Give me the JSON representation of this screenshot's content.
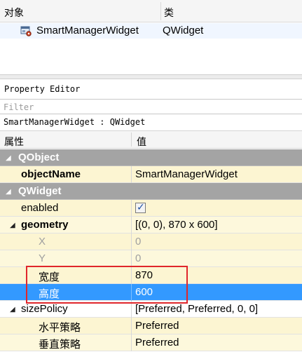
{
  "object_inspector": {
    "col_object": "对象",
    "col_class": "类",
    "row": {
      "name": "SmartManagerWidget",
      "class": "QWidget",
      "icon": "widget-icon"
    }
  },
  "property_editor": {
    "title": "Property Editor",
    "filter_placeholder": "Filter",
    "context": "SmartManagerWidget : QWidget",
    "col_property": "属性",
    "col_value": "值",
    "groups": {
      "qobject": "QObject",
      "qwidget": "QWidget"
    },
    "rows": {
      "objectName": {
        "label": "objectName",
        "value": "SmartManagerWidget"
      },
      "enabled": {
        "label": "enabled",
        "checked": true
      },
      "geometry": {
        "label": "geometry",
        "value": "[(0, 0), 870 x 600]"
      },
      "x": {
        "label": "X",
        "value": "0"
      },
      "y": {
        "label": "Y",
        "value": "0"
      },
      "width": {
        "label": "宽度",
        "value": "870"
      },
      "height": {
        "label": "高度",
        "value": "600"
      },
      "sizePolicy": {
        "label": "sizePolicy",
        "value": "[Preferred, Preferred, 0, 0]"
      },
      "hPolicy": {
        "label": "水平策略",
        "value": "Preferred"
      },
      "vPolicy": {
        "label": "垂直策略",
        "value": "Preferred"
      }
    }
  },
  "colors": {
    "group_header": "#a4a4a4",
    "selection": "#3399ff",
    "row_yellow": "#fcf5d2",
    "annotation_box": "#e0262b"
  }
}
